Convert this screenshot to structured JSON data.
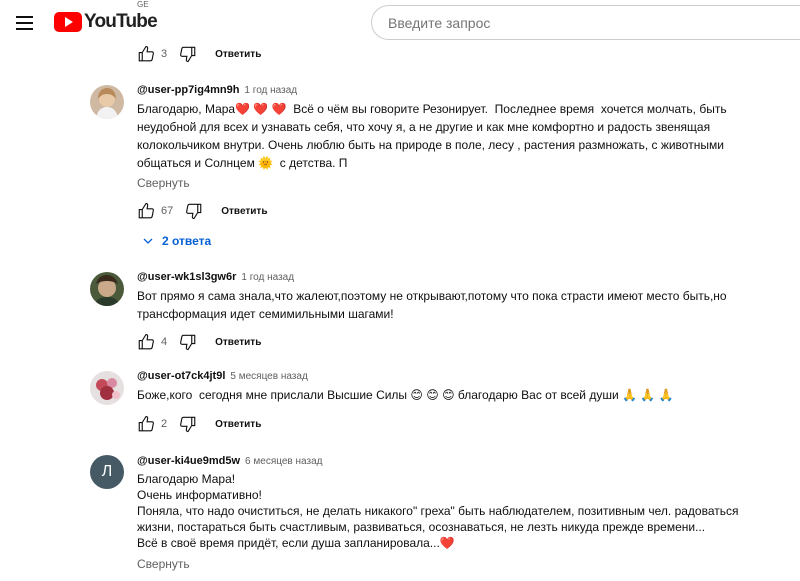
{
  "header": {
    "logo_text": "YouTube",
    "country_code": "GE",
    "search_placeholder": "Введите запрос"
  },
  "top_actions": {
    "likes": "3",
    "reply_label": "Ответить"
  },
  "comments": [
    {
      "author": "@user-pp7ig4mn9h",
      "time": "1 год назад",
      "text": "Благодарю, Мара❤️ ❤️ ❤️  Всё о чём вы говорите Резонирует.  Последнее время  хочется молчать, быть неудобной для всех и узнавать себя, что хочу я, а не другие и как мне комфортно и радость звенящая колокольчиком внутри. Очень люблю быть на природе в поле, лесу , растения размножать, с животными общаться и Солнцем 🌞  с детства. П",
      "toggle": "Свернуть",
      "likes": "67",
      "reply_label": "Ответить",
      "replies": "2 ответа"
    },
    {
      "author": "@user-wk1sl3gw6r",
      "time": "1 год назад",
      "text": "Вот прямо я сама знала,что жалеют,поэтому не открывают,потому что пока страсти имеют место быть,но трансформация идет семимильными шагами!",
      "likes": "4",
      "reply_label": "Ответить"
    },
    {
      "author": "@user-ot7ck4jt9l",
      "time": "5 месяцев назад",
      "text": "Боже,кого  сегодня мне прислали Высшие Силы 😊 😊 😊 благодарю Вас от всей души 🙏 🙏 🙏",
      "likes": "2",
      "reply_label": "Ответить"
    },
    {
      "author": "@user-ki4ue9md5w",
      "time": "6 месяцев назад",
      "avatar_letter": "Л",
      "text": "Благодарю Мара!\nОчень информативно!\nПоняла, что надо очиститься, не делать никакого\" греха\" быть наблюдателем, позитивным чел. радоваться жизни, постараться быть счастливым, развиваться, осознаваться, не лезть никуда прежде времени...\nВсё в своё время придёт, если душа запланировала...❤️",
      "toggle": "Свернуть"
    }
  ],
  "colors": {
    "brand_red": "#ff0000",
    "link_blue": "#065fd4",
    "avatar_letter_bg": "#455a64"
  }
}
